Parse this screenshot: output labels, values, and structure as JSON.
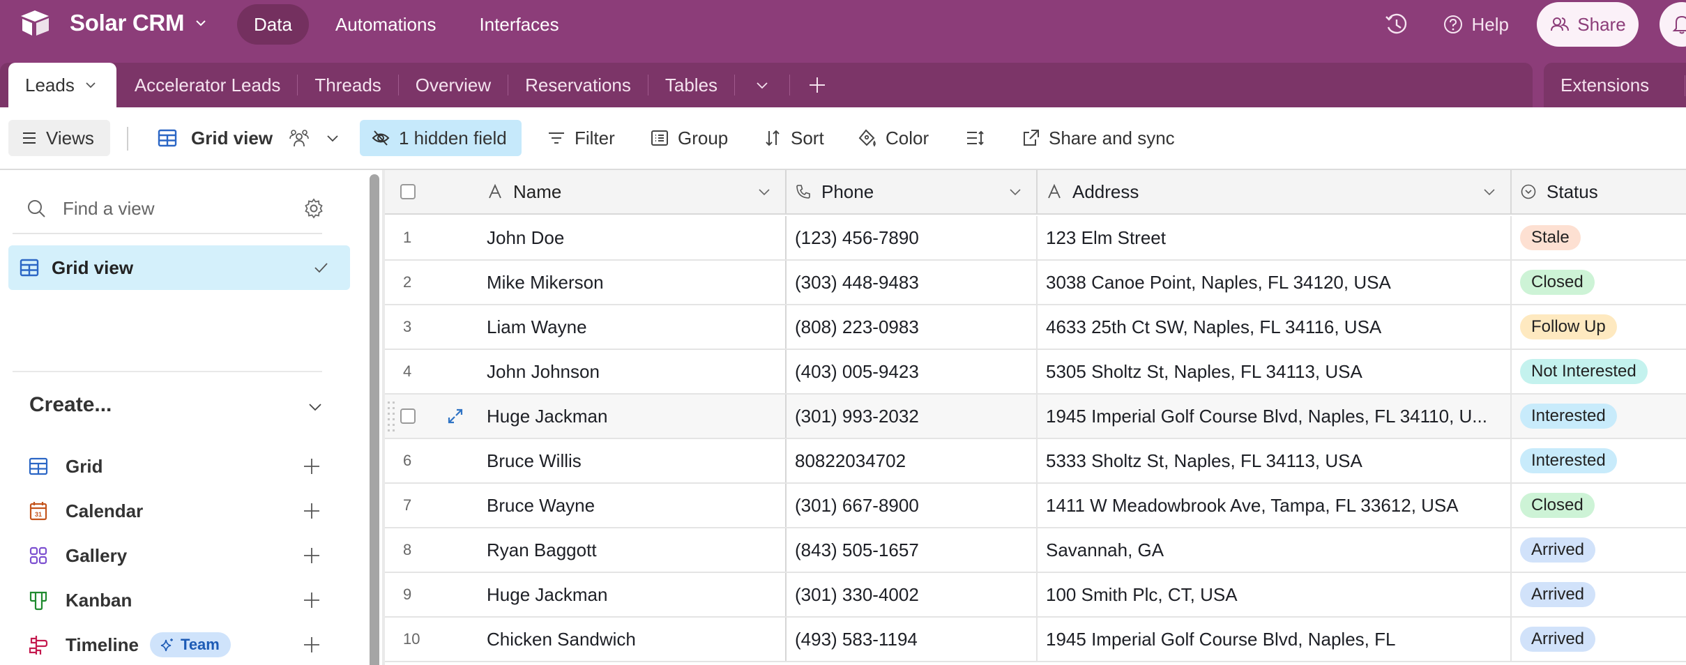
{
  "app": {
    "name": "Solar CRM",
    "nav": [
      "Data",
      "Automations",
      "Interfaces"
    ],
    "active_nav": 0,
    "help_label": "Help",
    "share_label": "Share",
    "brand_color": "#8c3d79"
  },
  "tables": {
    "tabs": [
      "Leads",
      "Accelerator Leads",
      "Threads",
      "Overview",
      "Reservations",
      "Tables"
    ],
    "active": 0,
    "extensions_label": "Extensions"
  },
  "toolbar": {
    "views_label": "Views",
    "view_name": "Grid view",
    "hidden_fields_label": "1 hidden field",
    "filter_label": "Filter",
    "group_label": "Group",
    "sort_label": "Sort",
    "color_label": "Color",
    "share_sync_label": "Share and sync"
  },
  "sidebar": {
    "find_placeholder": "Find a view",
    "views": [
      {
        "label": "Grid view",
        "selected": true
      }
    ],
    "create_heading": "Create...",
    "create_items": [
      {
        "label": "Grid",
        "icon": "grid-icon",
        "color": "#2b66c5"
      },
      {
        "label": "Calendar",
        "icon": "calendar-icon",
        "color": "#c4541c"
      },
      {
        "label": "Gallery",
        "icon": "gallery-icon",
        "color": "#7c4fd0"
      },
      {
        "label": "Kanban",
        "icon": "kanban-icon",
        "color": "#1f8a2e"
      },
      {
        "label": "Timeline",
        "icon": "timeline-icon",
        "color": "#c4194e",
        "badge": "Team"
      }
    ]
  },
  "grid": {
    "columns": [
      {
        "label": "Name",
        "icon": "text-field-icon"
      },
      {
        "label": "Phone",
        "icon": "phone-icon"
      },
      {
        "label": "Address",
        "icon": "text-field-icon"
      },
      {
        "label": "Status",
        "icon": "single-select-icon"
      }
    ],
    "status_colors": {
      "Stale": "#fde0d2",
      "Closed": "#cdf3d6",
      "Follow Up": "#fee9c0",
      "Not Interested": "#c4f2ee",
      "Interested": "#c8ebfb",
      "Arrived": "#d1e2fa"
    },
    "hovered_row": 5,
    "rows": [
      {
        "num": "1",
        "name": "John Doe",
        "phone": "(123) 456-7890",
        "address": "123 Elm Street",
        "status": "Stale"
      },
      {
        "num": "2",
        "name": "Mike Mikerson",
        "phone": "(303) 448-9483",
        "address": "3038 Canoe Point, Naples, FL 34120, USA",
        "status": "Closed"
      },
      {
        "num": "3",
        "name": "Liam Wayne",
        "phone": "(808) 223-0983",
        "address": "4633 25th Ct SW, Naples, FL 34116, USA",
        "status": "Follow Up"
      },
      {
        "num": "4",
        "name": "John Johnson",
        "phone": "(403) 005-9423",
        "address": "5305 Sholtz St, Naples, FL 34113, USA",
        "status": "Not Interested"
      },
      {
        "num": "5",
        "name": "Huge Jackman",
        "phone": "(301) 993-2032",
        "address": "1945 Imperial Golf Course Blvd, Naples, FL 34110, U...",
        "status": "Interested"
      },
      {
        "num": "6",
        "name": "Bruce Willis",
        "phone": "80822034702",
        "address": "5333 Sholtz St, Naples, FL 34113, USA",
        "status": "Interested"
      },
      {
        "num": "7",
        "name": "Bruce Wayne",
        "phone": "(301) 667-8900",
        "address": "1411 W Meadowbrook Ave, Tampa, FL 33612, USA",
        "status": "Closed"
      },
      {
        "num": "8",
        "name": "Ryan Baggott",
        "phone": "(843) 505-1657",
        "address": "Savannah, GA",
        "status": "Arrived"
      },
      {
        "num": "9",
        "name": "Huge Jackman",
        "phone": "(301) 330-4002",
        "address": "100 Smith Plc, CT, USA",
        "status": "Arrived"
      },
      {
        "num": "10",
        "name": "Chicken Sandwich",
        "phone": "(493) 583-1194",
        "address": "1945 Imperial Golf Course Blvd, Naples, FL",
        "status": "Arrived"
      }
    ]
  }
}
